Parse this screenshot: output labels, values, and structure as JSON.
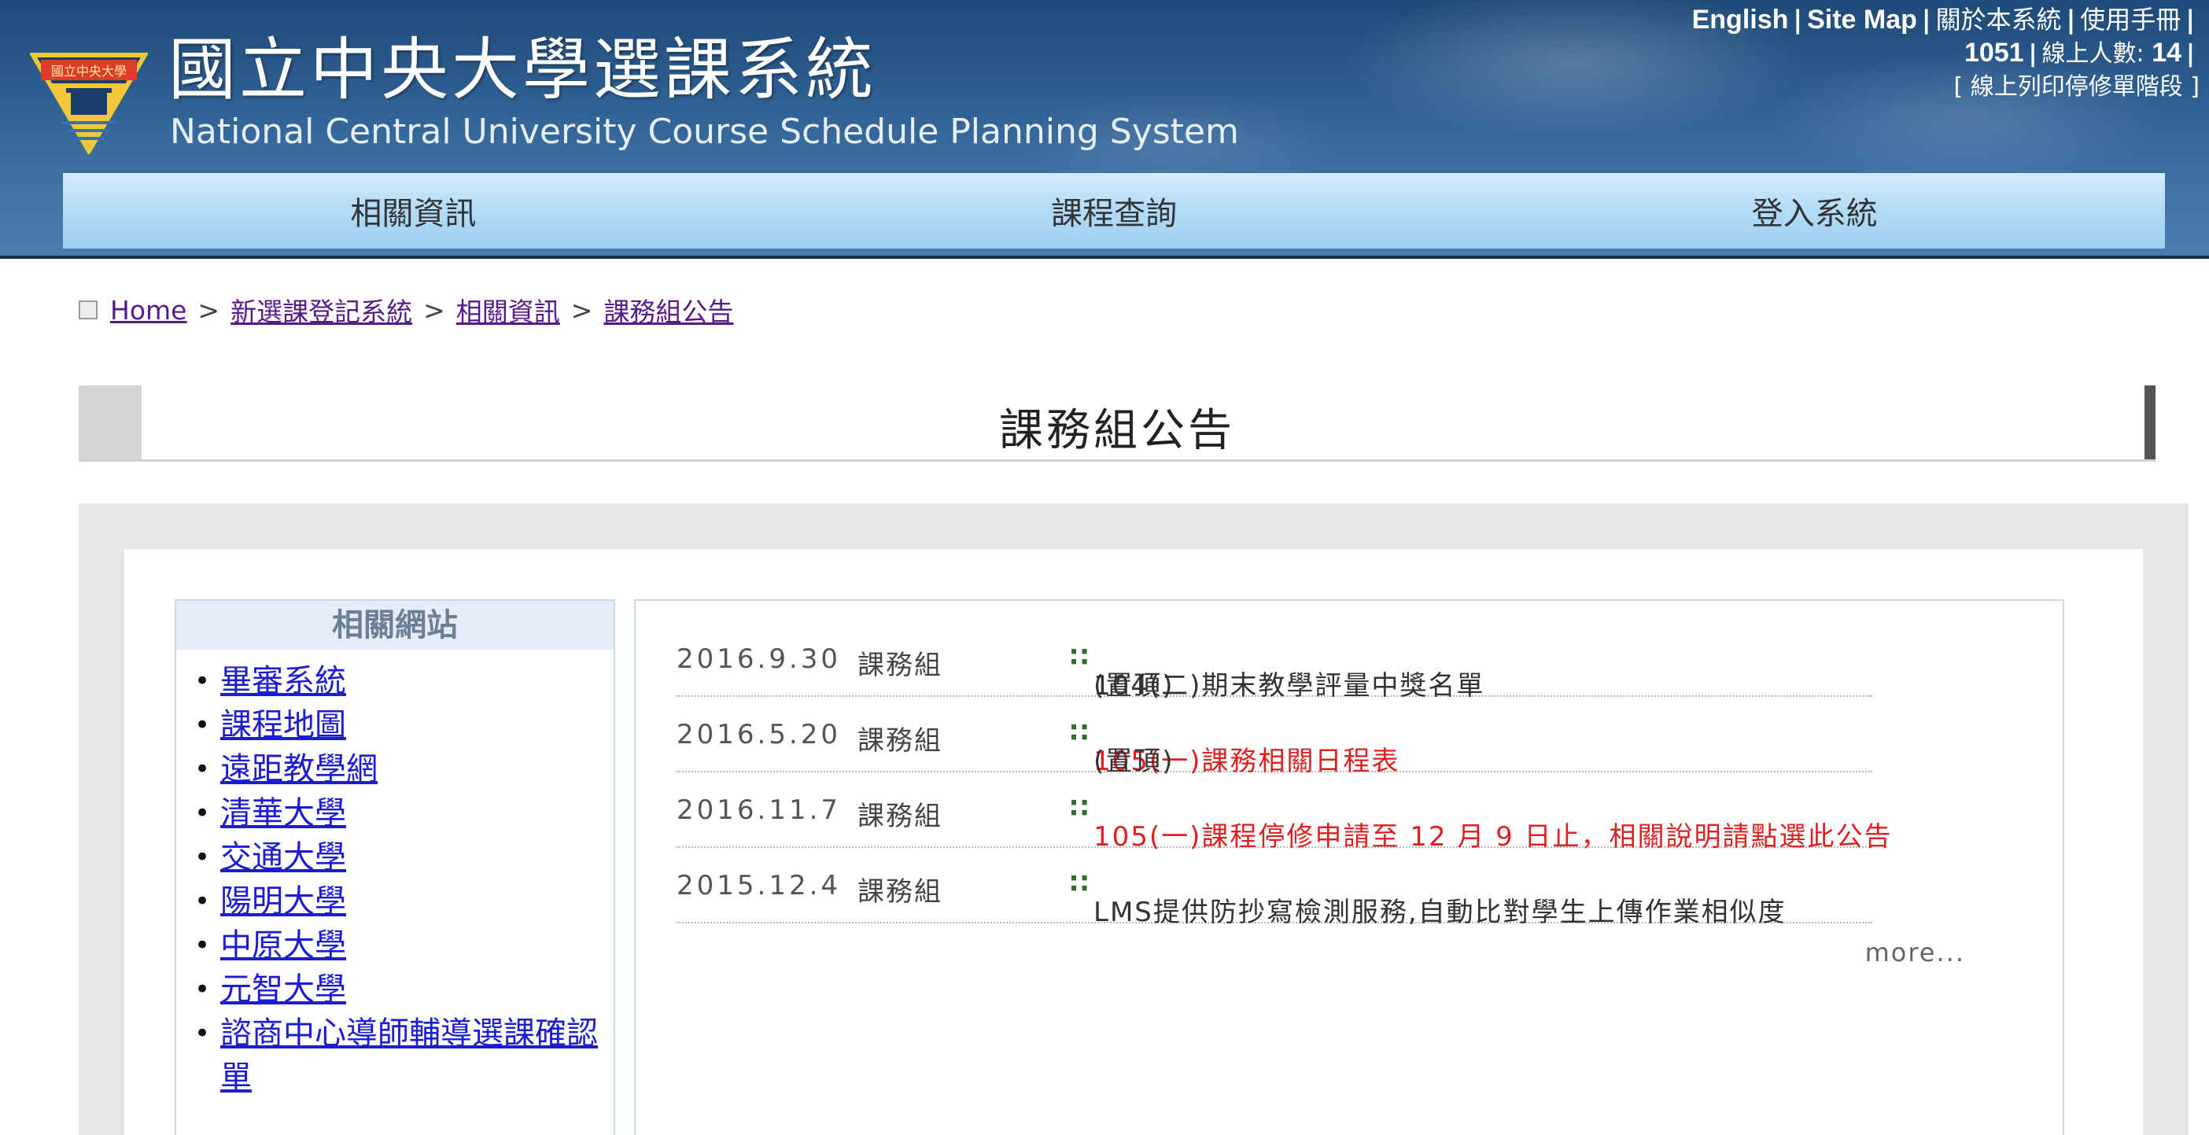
{
  "header": {
    "title": "國立中央大學選課系統",
    "subtitle": "National Central University Course Schedule Planning System",
    "logo_label": "國立中央大學",
    "top_links": {
      "english": "English",
      "sep": "|",
      "sitemap": "Site Map",
      "about": "關於本系統",
      "manual": "使用手冊",
      "term": "1051",
      "online_label": "線上人數:",
      "online_count": "14",
      "stage": "[ 線上列印停修單階段 ]"
    }
  },
  "nav": {
    "items": [
      "相關資訊",
      "課程查詢",
      "登入系統"
    ]
  },
  "breadcrumb": {
    "home": "Home",
    "level1": "新選課登記系統",
    "level2": "相關資訊",
    "level3": "課務組公告",
    "arrow": ">"
  },
  "page": {
    "title": "課務組公告"
  },
  "sidebar": {
    "title": "相關網站",
    "bullet": "•",
    "links": [
      "畢審系統",
      "課程地圖",
      "遠距教學網",
      "清華大學",
      "交通大學",
      "陽明大學",
      "中原大學",
      "元智大學",
      "諮商中心導師輔導選課確認單"
    ]
  },
  "announcements": {
    "bullet": "∷",
    "items": [
      {
        "date": "2016.9.30",
        "unit": "課務組",
        "text": "104(二)期末教學評量中獎名單",
        "suffix": " (置頂)",
        "color": "#333333"
      },
      {
        "date": "2016.5.20",
        "unit": "課務組",
        "text": "105(一)課務相關日程表",
        "suffix": " (置頂)",
        "color": "#e02020"
      },
      {
        "date": "2016.11.7",
        "unit": "課務組",
        "text": "105(一)課程停修申請至 12 月 9 日止，相關說明請點選此公告",
        "suffix": "",
        "color": "#e02020"
      },
      {
        "date": "2015.12.4",
        "unit": "課務組",
        "text": "LMS提供防抄寫檢測服務,自動比對學生上傳作業相似度",
        "suffix": "",
        "color": "#333333"
      }
    ],
    "more": "more..."
  }
}
